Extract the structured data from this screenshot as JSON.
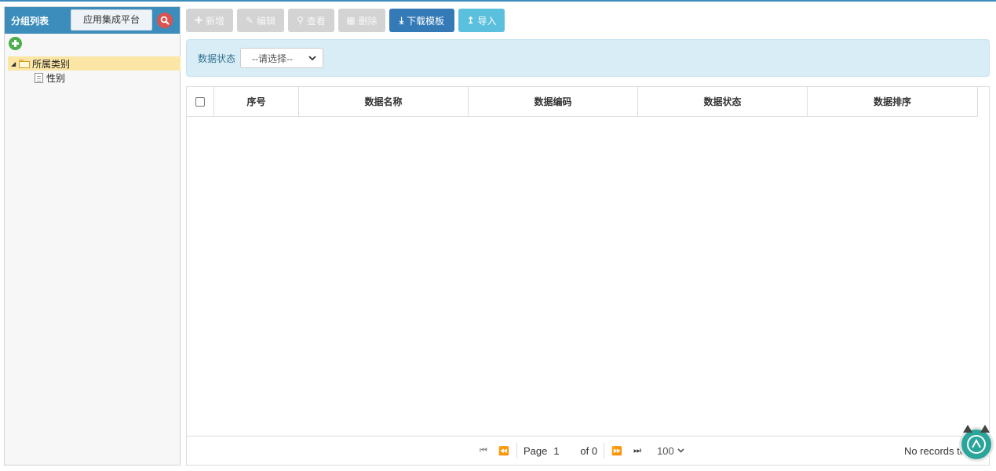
{
  "sidebar": {
    "title": "分组列表",
    "search_value": "应用集成平台",
    "tree": {
      "root_label": "所属类别",
      "children": [
        "性别"
      ]
    }
  },
  "toolbar": {
    "add": "新增",
    "edit": "编辑",
    "view": "查看",
    "delete": "删除",
    "download_template": "下载模板",
    "import": "导入"
  },
  "filter": {
    "label": "数据状态",
    "select_value": "--请选择--"
  },
  "table": {
    "columns": [
      "序号",
      "数据名称",
      "数据编码",
      "数据状态",
      "数据排序"
    ],
    "rows": []
  },
  "pager": {
    "page_label": "Page",
    "page_value": "1",
    "of_label": "of 0",
    "page_size": "100",
    "records_text": "No records to"
  },
  "colors": {
    "header_blue": "#3c8dbc",
    "primary": "#337ab7",
    "info": "#5bc0de",
    "disabled": "#d3d3d3",
    "filter_bg": "#d9edf7",
    "tree_selected": "#fbe6a6"
  }
}
